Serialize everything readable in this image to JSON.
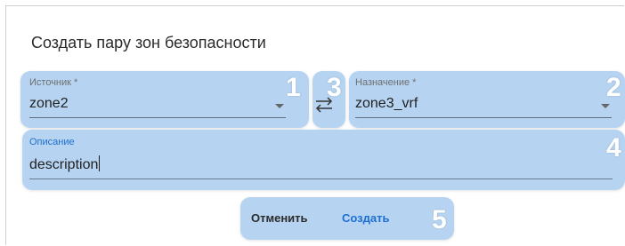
{
  "dialog": {
    "title": "Создать пару зон безопасности"
  },
  "source": {
    "label": "Источник *",
    "value": "zone2",
    "marker": "1"
  },
  "swap": {
    "icon": "swap-arrows-icon",
    "marker": "3"
  },
  "destination": {
    "label": "Назначение *",
    "value": "zone3_vrf",
    "marker": "2"
  },
  "description": {
    "label": "Описание",
    "value": "description",
    "marker": "4"
  },
  "actions": {
    "cancel_label": "Отменить",
    "create_label": "Создать",
    "marker": "5"
  },
  "colors": {
    "highlight": "#b6d4f2",
    "accent": "#1e6fd0",
    "text": "#212121"
  }
}
